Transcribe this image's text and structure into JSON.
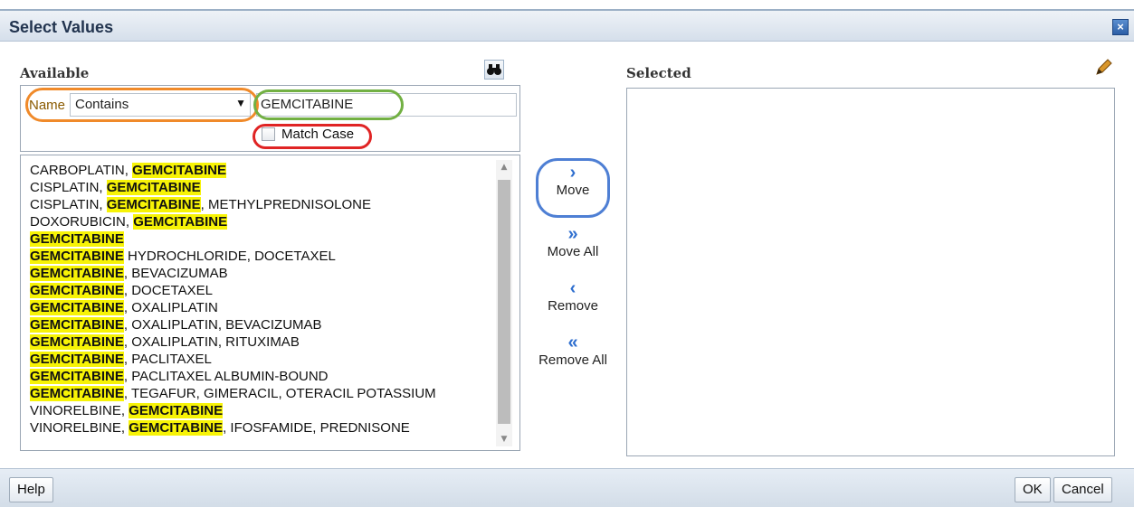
{
  "dialog": {
    "title": "Select Values",
    "close_icon": "close-icon"
  },
  "available": {
    "heading": "Available",
    "search": {
      "name_label": "Name",
      "operator": "Contains",
      "value": "GEMCITABINE",
      "match_case_label": "Match Case",
      "match_case_checked": false
    },
    "items": [
      {
        "parts": [
          {
            "t": "CARBOPLATIN, ",
            "h": false
          },
          {
            "t": "GEMCITABINE",
            "h": true
          }
        ]
      },
      {
        "parts": [
          {
            "t": "CISPLATIN, ",
            "h": false
          },
          {
            "t": "GEMCITABINE",
            "h": true
          }
        ]
      },
      {
        "parts": [
          {
            "t": "CISPLATIN, ",
            "h": false
          },
          {
            "t": "GEMCITABINE",
            "h": true
          },
          {
            "t": ", METHYLPREDNISOLONE",
            "h": false
          }
        ]
      },
      {
        "parts": [
          {
            "t": "DOXORUBICIN, ",
            "h": false
          },
          {
            "t": "GEMCITABINE",
            "h": true
          }
        ]
      },
      {
        "parts": [
          {
            "t": "GEMCITABINE",
            "h": true
          }
        ]
      },
      {
        "parts": [
          {
            "t": "GEMCITABINE",
            "h": true
          },
          {
            "t": " HYDROCHLORIDE, DOCETAXEL",
            "h": false
          }
        ]
      },
      {
        "parts": [
          {
            "t": "GEMCITABINE",
            "h": true
          },
          {
            "t": ", BEVACIZUMAB",
            "h": false
          }
        ]
      },
      {
        "parts": [
          {
            "t": "GEMCITABINE",
            "h": true
          },
          {
            "t": ", DOCETAXEL",
            "h": false
          }
        ]
      },
      {
        "parts": [
          {
            "t": "GEMCITABINE",
            "h": true
          },
          {
            "t": ", OXALIPLATIN",
            "h": false
          }
        ]
      },
      {
        "parts": [
          {
            "t": "GEMCITABINE",
            "h": true
          },
          {
            "t": ", OXALIPLATIN, BEVACIZUMAB",
            "h": false
          }
        ]
      },
      {
        "parts": [
          {
            "t": "GEMCITABINE",
            "h": true
          },
          {
            "t": ", OXALIPLATIN, RITUXIMAB",
            "h": false
          }
        ]
      },
      {
        "parts": [
          {
            "t": "GEMCITABINE",
            "h": true
          },
          {
            "t": ", PACLITAXEL",
            "h": false
          }
        ]
      },
      {
        "parts": [
          {
            "t": "GEMCITABINE",
            "h": true
          },
          {
            "t": ", PACLITAXEL ALBUMIN-BOUND",
            "h": false
          }
        ]
      },
      {
        "parts": [
          {
            "t": "GEMCITABINE",
            "h": true
          },
          {
            "t": ", TEGAFUR, GIMERACIL, OTERACIL POTASSIUM",
            "h": false
          }
        ]
      },
      {
        "parts": [
          {
            "t": "VINORELBINE, ",
            "h": false
          },
          {
            "t": "GEMCITABINE",
            "h": true
          }
        ]
      },
      {
        "parts": [
          {
            "t": "VINORELBINE, ",
            "h": false
          },
          {
            "t": "GEMCITABINE",
            "h": true
          },
          {
            "t": ", IFOSFAMIDE, PREDNISONE",
            "h": false
          }
        ]
      }
    ]
  },
  "shuttle": {
    "move": "Move",
    "move_all": "Move All",
    "remove": "Remove",
    "remove_all": "Remove All"
  },
  "selected": {
    "heading": "Selected",
    "items": []
  },
  "footer": {
    "help": "Help",
    "ok": "OK",
    "cancel": "Cancel"
  },
  "colors": {
    "highlight": "#f7f306",
    "annotation_orange": "#f08a2a",
    "annotation_green": "#72b043",
    "annotation_red": "#e02424",
    "annotation_blue": "#4e7fd4"
  }
}
